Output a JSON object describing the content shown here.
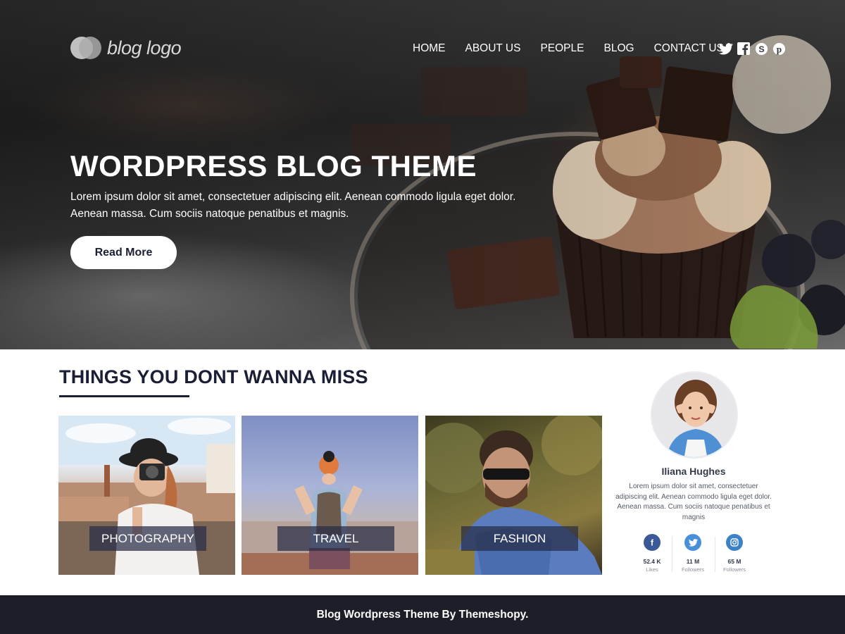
{
  "header": {
    "logo_text": "blog logo",
    "nav": [
      "HOME",
      "ABOUT US",
      "PEOPLE",
      "BLOG",
      "CONTACT US"
    ],
    "social_icons": [
      "twitter-icon",
      "facebook-icon",
      "skype-icon",
      "pinterest-icon"
    ]
  },
  "hero": {
    "title": "WORDPRESS BLOG THEME",
    "text": "Lorem ipsum dolor sit amet, consectetuer adipiscing elit. Aenean commodo ligula eget dolor. Aenean massa. Cum sociis natoque penatibus et magnis.",
    "button": "Read More"
  },
  "miss": {
    "title": "THINGS YOU DONT WANNA MISS",
    "cards": [
      {
        "label": "PHOTOGRAPHY"
      },
      {
        "label": "TRAVEL"
      },
      {
        "label": "FASHION"
      }
    ]
  },
  "profile": {
    "name": "Iliana Hughes",
    "bio": "Lorem ipsum dolor sit amet, consectetuer adipiscing elit. Aenean commodo ligula eget dolor. Aenean massa. Cum sociis natoque penatibus et magnis",
    "stats": [
      {
        "value": "52.4 K",
        "label": "Likes",
        "icon": "facebook-icon",
        "color": "#3b5998"
      },
      {
        "value": "11 M",
        "label": "Followers",
        "icon": "twitter-icon",
        "color": "#4a90d9"
      },
      {
        "value": "65 M",
        "label": "Followers",
        "icon": "instagram-icon",
        "color": "#3d82c4"
      }
    ]
  },
  "footer": {
    "text": "Blog Wordpress Theme By Themeshopy."
  },
  "colors": {
    "primary_dark": "#1b1f35",
    "footer_bg": "#1d1e27",
    "card_label_bg": "#282c46"
  }
}
